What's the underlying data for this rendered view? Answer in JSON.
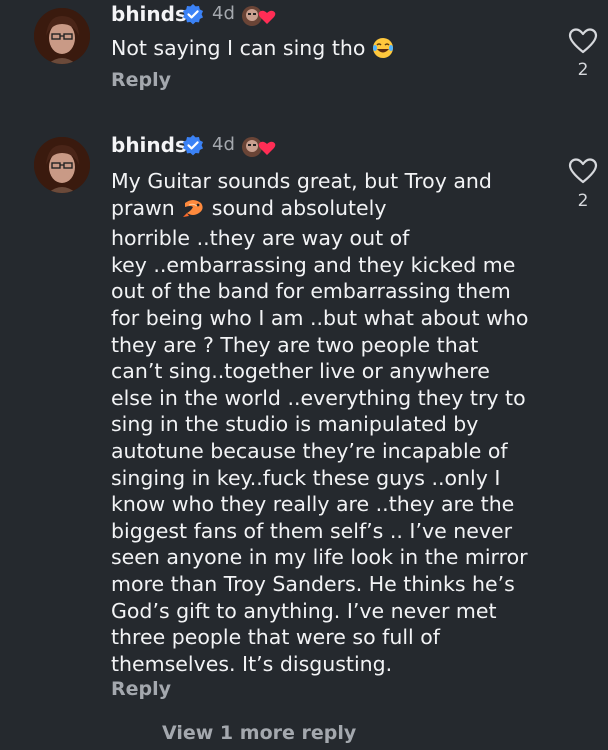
{
  "comments": [
    {
      "username": "bhinds",
      "verified": true,
      "age": "4d",
      "text": "Not saying I can sing tho",
      "text_emoji": "face-with-tears-of-joy",
      "reply_label": "Reply",
      "like_count": "2"
    },
    {
      "username": "bhinds",
      "verified": true,
      "age": "4d",
      "text_part1": "My Guitar sounds great, but Troy and\nprawn ",
      "text_emoji": "shrimp",
      "text_part2": " sound absolutely\nhorrible ..they are way out of\nkey ..embarrassing and they kicked me\nout of the band for embarrassing them\nfor being who I am ..but what about who\nthey are ? They are two people that\ncan’t sing..together live or anywhere\nelse in the world ..everything they try to\nsing in the studio is manipulated by\nautotune because they’re incapable of\nsinging in key..fuck these guys ..only I\nknow who they really are ..they are the\nbiggest fans of them self’s .. I’ve never\nseen anyone in my life look in the mirror\nmore than Troy Sanders. He thinks he’s\nGod’s gift to anything. I’ve never met\nthree people that were so full of\nthemselves. It’s disgusting.",
      "reply_label": "Reply",
      "like_count": "2"
    }
  ],
  "view_more_label": "View 1 more reply",
  "colors": {
    "background": "#25292e",
    "verified": "#3b82f6",
    "heart": "#ff2d55",
    "secondary_text": "#a4a8ae"
  }
}
